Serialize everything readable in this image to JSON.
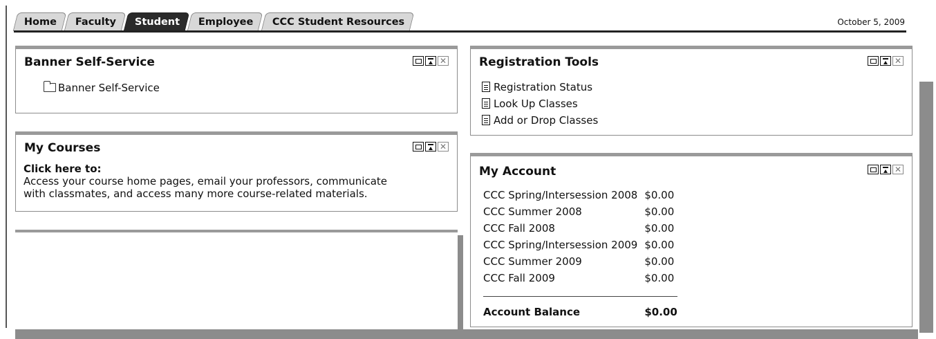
{
  "tabs": [
    {
      "label": "Home",
      "active": false
    },
    {
      "label": "Faculty",
      "active": false
    },
    {
      "label": "Student",
      "active": true
    },
    {
      "label": "Employee",
      "active": false
    },
    {
      "label": "CCC Student Resources",
      "active": false
    }
  ],
  "date": "October 5, 2009",
  "banner": {
    "title": "Banner Self-Service",
    "link": "Banner Self-Service"
  },
  "courses": {
    "title": "My Courses",
    "link_heading": "Click here to:",
    "description_line1": "Access your course home pages, email your professors, communicate",
    "description_line2": "with classmates, and access many more course-related materials."
  },
  "registration": {
    "title": "Registration Tools",
    "links": [
      "Registration Status",
      "Look Up Classes",
      "Add or Drop Classes"
    ]
  },
  "account": {
    "title": "My Account",
    "rows": [
      {
        "term": "CCC Spring/Intersession 2008",
        "amount": "$0.00"
      },
      {
        "term": "CCC Summer 2008",
        "amount": "$0.00"
      },
      {
        "term": "CCC Fall 2008",
        "amount": "$0.00"
      },
      {
        "term": "CCC Spring/Intersession 2009",
        "amount": "$0.00"
      },
      {
        "term": "CCC Summer 2009",
        "amount": "$0.00"
      },
      {
        "term": "CCC Fall 2009",
        "amount": "$0.00"
      }
    ],
    "total_label": "Account Balance",
    "total_amount": "$0.00"
  },
  "portlet_controls": {
    "maximize_icon": "maximize-icon",
    "move_top_icon": "move-to-top-icon",
    "close_icon": "close-icon"
  }
}
